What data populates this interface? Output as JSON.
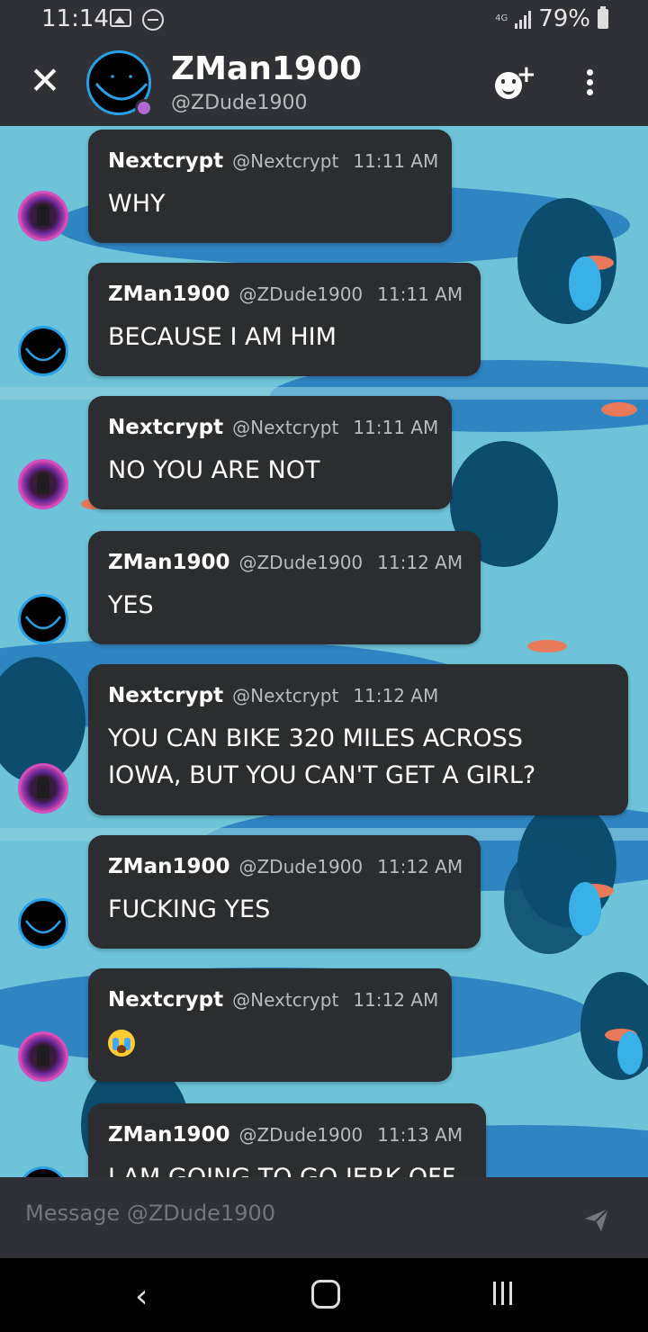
{
  "status_bar": {
    "time": "11:14",
    "network": "4G",
    "battery": "79%"
  },
  "header": {
    "close_icon": "close-icon",
    "name": "ZMan1900",
    "handle": "@ZDude1900",
    "add_friend_icon": "add-friend-icon",
    "menu_icon": "more-vert-icon"
  },
  "messages": [
    {
      "author": "Nextcrypt",
      "handle": "@Nextcrypt",
      "time": "11:11 AM",
      "text": "WHY"
    },
    {
      "author": "ZMan1900",
      "handle": "@ZDude1900",
      "time": "11:11 AM",
      "text": "BECAUSE I AM HIM"
    },
    {
      "author": "Nextcrypt",
      "handle": "@Nextcrypt",
      "time": "11:11 AM",
      "text": "NO YOU ARE NOT"
    },
    {
      "author": "ZMan1900",
      "handle": "@ZDude1900",
      "time": "11:12 AM",
      "text": "YES"
    },
    {
      "author": "Nextcrypt",
      "handle": "@Nextcrypt",
      "time": "11:12 AM",
      "text": "YOU CAN BIKE 320 MILES ACROSS IOWA, BUT YOU CAN'T GET A GIRL?"
    },
    {
      "author": "ZMan1900",
      "handle": "@ZDude1900",
      "time": "11:12 AM",
      "text": "FUCKING YES"
    },
    {
      "author": "Nextcrypt",
      "handle": "@Nextcrypt",
      "time": "11:12 AM",
      "text": "",
      "emoji": "loudly-crying-face-emoji"
    },
    {
      "author": "ZMan1900",
      "handle": "@ZDude1900",
      "time": "11:13 AM",
      "text": "I AM GOING TO GO JERK OFF"
    }
  ],
  "composer": {
    "placeholder": "Message @ZDude1900",
    "send_icon": "send-icon"
  },
  "colors": {
    "background": "#2f3136",
    "bubble": "#2b2d31",
    "wallpaper": "#6ec3d8",
    "accent": "#29a0e6",
    "presence": "#b168d4"
  }
}
